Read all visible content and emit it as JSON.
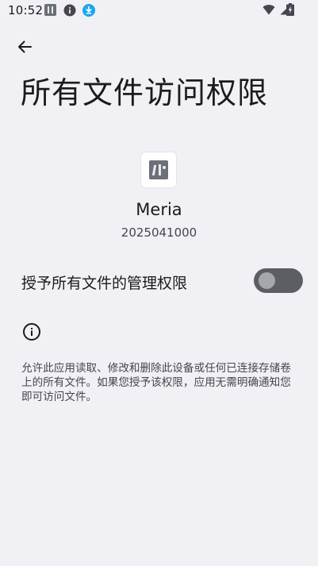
{
  "status_bar": {
    "time": "10:52",
    "icons": [
      "app-notification-icon",
      "info-icon",
      "download-icon",
      "wifi-icon",
      "signal-icon",
      "battery-icon"
    ]
  },
  "header": {
    "back_icon": "arrow-left-icon",
    "title": "所有文件访问权限"
  },
  "app": {
    "name": "Meria",
    "version": "2025041000"
  },
  "permission": {
    "label": "授予所有文件的管理权限",
    "enabled": false
  },
  "footer": {
    "info_icon": "info-outline-icon",
    "description": "允许此应用读取、修改和删除此设备或任何已连接存储卷上的所有文件。如果您授予该权限，应用无需明确通知您即可访问文件。"
  },
  "colors": {
    "background": "#f1f0f4",
    "toggle_track_off": "#5d5e64",
    "toggle_knob_off": "#a6a7ad",
    "download_badge": "#1aa7ec"
  }
}
